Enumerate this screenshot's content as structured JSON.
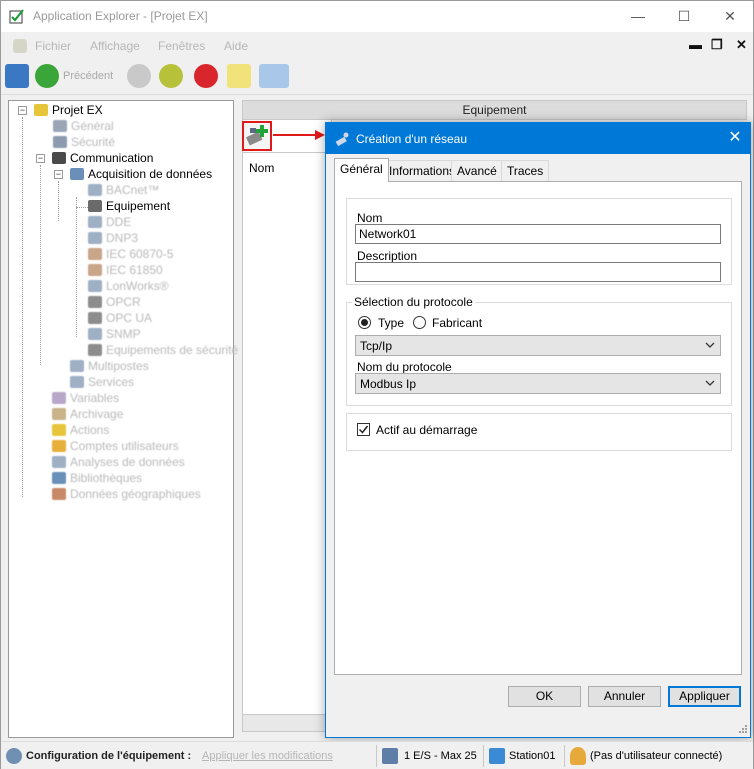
{
  "window": {
    "title": "Application Explorer - [Projet EX]",
    "controls": {
      "minimize": "—",
      "maximize": "☐",
      "close": "✕"
    }
  },
  "menu": {
    "items": [
      "Fichier",
      "Affichage",
      "Fenêtres",
      "Aide"
    ],
    "mdi_controls": {
      "minimize": "▬",
      "restore": "❐",
      "close": "✕"
    }
  },
  "toolbar": {
    "previous_label": "Précédent"
  },
  "tree": {
    "root": "Projet EX",
    "general": "Général",
    "security": "Sécurité",
    "communication": "Communication",
    "acquisition": "Acquisition de données",
    "bacnet": "BACnet™",
    "equipement": "Equipement",
    "protocols": [
      "DDE",
      "DNP3",
      "IEC 60870-5",
      "IEC 61850",
      "LonWorks®",
      "OPCR",
      "OPC UA",
      "SNMP",
      "Equipements de sécurité"
    ],
    "multipostes": "Multipostes",
    "services": "Services",
    "bottom_items": [
      "Variables",
      "Archivage",
      "Actions",
      "Comptes utilisateurs",
      "Analyses de données",
      "Bibliothèques",
      "Données géographiques"
    ]
  },
  "equipment_panel": {
    "header": "Equipement",
    "column_nom": "Nom"
  },
  "dialog": {
    "title": "Création d'un réseau",
    "close": "✕",
    "tabs": [
      "Général",
      "Informations",
      "Avancé",
      "Traces"
    ],
    "active_tab": "Général",
    "name_label": "Nom",
    "name_value": "Network01",
    "description_label": "Description",
    "description_value": "",
    "protocol_group_label": "Sélection du protocole",
    "radio_type": "Type",
    "radio_fabricant": "Fabricant",
    "selected_radio": "Type",
    "type_combo_value": "Tcp/Ip",
    "protocol_name_label": "Nom du protocole",
    "protocol_combo_value": "Modbus Ip",
    "active_on_start_label": "Actif au démarrage",
    "active_on_start_checked": true,
    "ok_label": "OK",
    "cancel_label": "Annuler",
    "apply_label": "Appliquer"
  },
  "statusbar": {
    "config_label": "Configuration de l'équipement :",
    "apply_link": "Appliquer les modifications",
    "io_count": "1 E/S - Max 25",
    "station": "Station01",
    "user": "(Pas d'utilisateur connecté)"
  },
  "colors": {
    "accent": "#0078d7",
    "highlight_border": "#e01a1a"
  }
}
